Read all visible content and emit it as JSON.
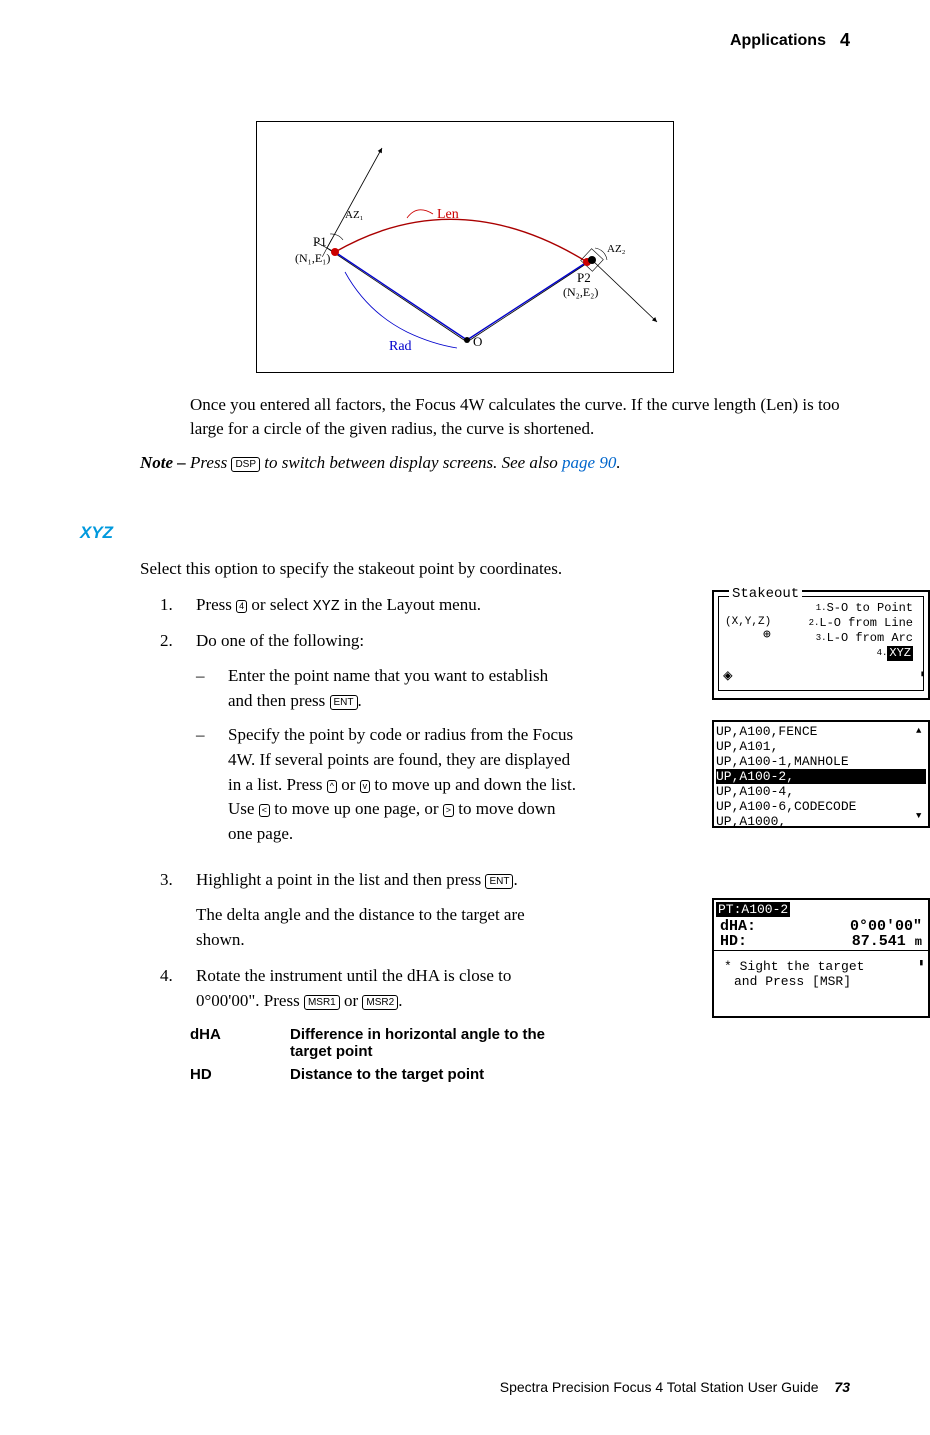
{
  "header": {
    "title": "Applications",
    "chapter": "4"
  },
  "diagram": {
    "labels": {
      "p1": "P1",
      "p1_coord": "(N₁,E₁)",
      "p2": "P2",
      "p2_coord": "(N₂,E₂)",
      "az1": "AZ₁",
      "az2": "AZ₂",
      "len": "Len",
      "rad": "Rad",
      "o": "O"
    }
  },
  "body": {
    "para1": "Once you entered all factors, the Focus 4W calculates the curve. If the curve length (Len) is too large for a circle of the given radius, the curve is shortened.",
    "note_label": "Note – ",
    "note_pre": "Press ",
    "note_key": "DSP",
    "note_mid": " to switch between display screens. See also ",
    "note_link": "page 90",
    "note_end": "."
  },
  "section": {
    "heading": "XYZ",
    "intro": "Select this option to specify the stakeout point by coordinates.",
    "step1_pre": "Press ",
    "step1_key": "4",
    "step1_mid": " or select ",
    "step1_xyz": "XYZ",
    "step1_end": " in the Layout menu.",
    "step2": "Do one of the following:",
    "step2a_pre": "Enter the point name that you want to establish and then press ",
    "step2a_key": "ENT",
    "step2a_end": ".",
    "step2b_pre": "Specify the point by code or radius from the Focus 4W. If several points are found, they are displayed in a list. Press ",
    "step2b_key1": "^",
    "step2b_mid1": " or ",
    "step2b_key2": "v",
    "step2b_mid2": " to move up and down the list. Use ",
    "step2b_key3": "<",
    "step2b_mid3": " to move up one page, or ",
    "step2b_key4": ">",
    "step2b_end": " to move down one page.",
    "step3_pre": "Highlight a point in the list and then press ",
    "step3_key": "ENT",
    "step3_end": ".",
    "step3_para": "The delta angle and the distance to the target are shown.",
    "step4_pre": "Rotate the instrument until the dHA is close to 0°00'00\". Press ",
    "step4_key1": "MSR1",
    "step4_mid": " or ",
    "step4_key2": "MSR2",
    "step4_end": "."
  },
  "definitions": {
    "dha_term": "dHA",
    "dha_desc": "Difference in horizontal angle to the target point",
    "hd_term": "HD",
    "hd_desc": "Distance to the target point"
  },
  "screens": {
    "s1": {
      "title": "Stakeout",
      "xyz_label": "(X,Y,Z)",
      "items": [
        "S-O to Point",
        "L-O from Line",
        "L-O from Arc",
        "XYZ"
      ]
    },
    "s2": {
      "rows": [
        "UP,A100,FENCE",
        "UP,A101,",
        "UP,A100-1,MANHOLE",
        "UP,A100-2,",
        "UP,A100-4,",
        "UP,A100-6,CODECODE",
        "UP,A1000,"
      ],
      "highlight_index": 3
    },
    "s3": {
      "pt": "PT:A100-2",
      "dha_label": "dHA:",
      "dha_val": "0°00'00\"",
      "hd_label": "HD:",
      "hd_val": "87.541",
      "hd_unit": "m",
      "msg1": "* Sight the target",
      "msg2": "and Press [MSR]"
    }
  },
  "footer": {
    "text": "Spectra Precision Focus 4 Total Station User Guide",
    "page": "73"
  }
}
